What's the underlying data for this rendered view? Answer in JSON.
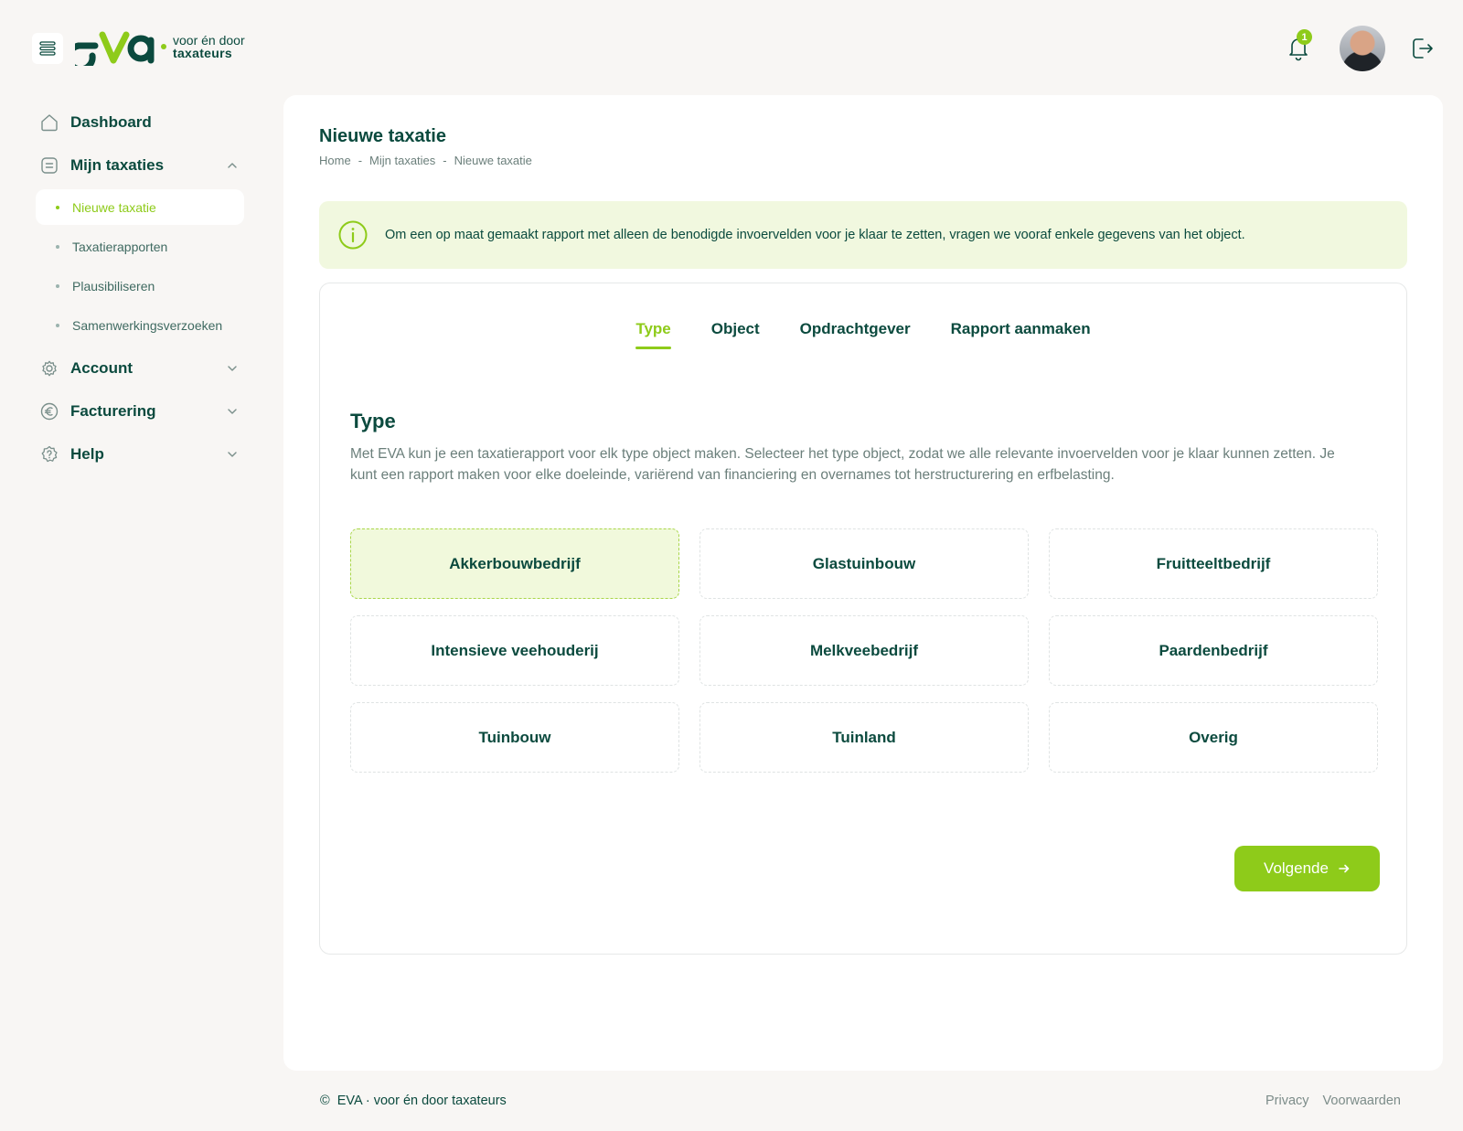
{
  "header": {
    "logo_text": "eva",
    "tagline_line1": "voor én door",
    "tagline_line2": "taxateurs",
    "notification_count": "1"
  },
  "sidebar": {
    "items": [
      {
        "label": "Dashboard"
      },
      {
        "label": "Mijn taxaties",
        "expanded": true,
        "children": [
          "Nieuwe taxatie",
          "Taxatierapporten",
          "Plausibiliseren",
          "Samenwerkingsverzoeken"
        ]
      },
      {
        "label": "Account"
      },
      {
        "label": "Facturering"
      },
      {
        "label": "Help"
      }
    ],
    "active_child": "Nieuwe taxatie"
  },
  "page": {
    "title": "Nieuwe taxatie",
    "breadcrumb": [
      "Home",
      "Mijn taxaties",
      "Nieuwe taxatie"
    ],
    "breadcrumb_separator": "-",
    "info": "Om een op maat gemaakt rapport met alleen de benodigde invoervelden voor je klaar te zetten, vragen we vooraf enkele gegevens van het object."
  },
  "wizard": {
    "tabs": [
      "Type",
      "Object",
      "Opdrachtgever",
      "Rapport aanmaken"
    ],
    "active_tab": "Type",
    "section_title": "Type",
    "section_desc": "Met EVA kun je een taxatierapport voor elk type object maken. Selecteer het type object, zodat we alle relevante invoervelden voor je klaar kunnen zetten. Je kunt een rapport maken voor elke doeleinde, variërend van financiering en overnames tot herstructurering en erfbelasting.",
    "options": [
      "Akkerbouwbedrijf",
      "Glastuinbouw",
      "Fruitteeltbedrijf",
      "Intensieve veehouderij",
      "Melkveebedrijf",
      "Paardenbedrijf",
      "Tuinbouw",
      "Tuinland",
      "Overig"
    ],
    "selected_option": "Akkerbouwbedrijf",
    "next_label": "Volgende"
  },
  "footer": {
    "copyright_symbol": "©",
    "copyright": "EVA · voor én door taxateurs",
    "links": [
      "Privacy",
      "Voorwaarden"
    ]
  },
  "colors": {
    "accent": "#8ecb1a",
    "primary_text": "#0b4a3e",
    "background": "#f8f6f4"
  }
}
